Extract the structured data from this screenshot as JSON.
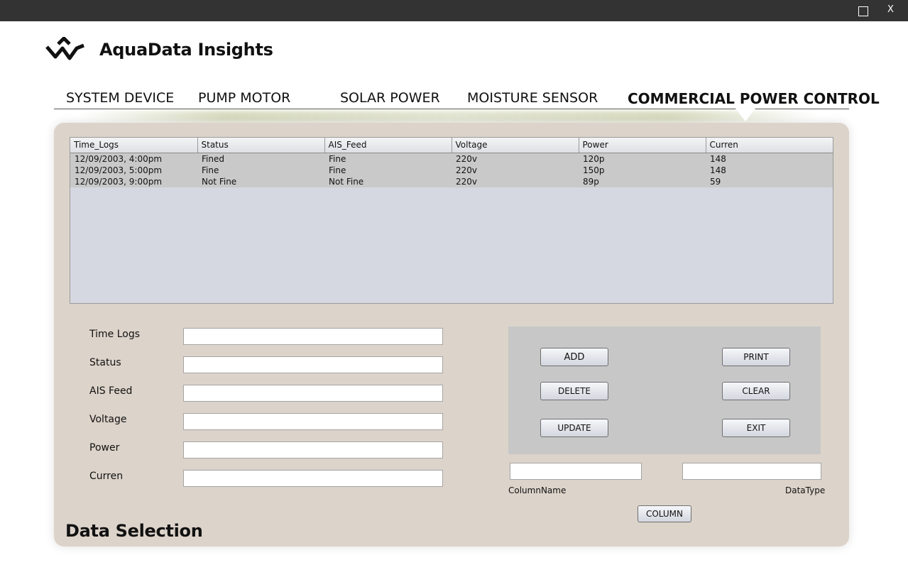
{
  "window": {
    "maximize_label": "",
    "close_label": "X"
  },
  "app": {
    "title": "AquaData Insights",
    "logo_icon": "wave-chevron-logo-icon"
  },
  "nav": {
    "items": [
      {
        "label": "SYSTEM DEVICE"
      },
      {
        "label": "PUMP MOTOR"
      },
      {
        "label": "SOLAR POWER"
      },
      {
        "label": "MOISTURE SENSOR"
      },
      {
        "label": "COMMERCIAL POWER CONTROL"
      }
    ],
    "active_index": 4
  },
  "table": {
    "columns": [
      "Time_Logs",
      "Status",
      "AIS_Feed",
      "Voltage",
      "Power",
      "Curren"
    ],
    "rows": [
      [
        "12/09/2003, 4:00pm",
        "Fined",
        "Fine",
        "220v",
        "120p",
        "148"
      ],
      [
        "12/09/2003, 5:00pm",
        "Fine",
        "Fine",
        "220v",
        "150p",
        "148"
      ],
      [
        "12/09/2003, 9:00pm",
        "Not Fine",
        "Not Fine",
        "220v",
        "89p",
        "59"
      ]
    ]
  },
  "form": {
    "fields": [
      {
        "label": "Time Logs",
        "value": ""
      },
      {
        "label": "Status",
        "value": ""
      },
      {
        "label": "AIS Feed",
        "value": ""
      },
      {
        "label": "Voltage",
        "value": ""
      },
      {
        "label": "Power",
        "value": ""
      },
      {
        "label": "Curren",
        "value": ""
      }
    ]
  },
  "buttons": {
    "add": "ADD",
    "print": "PRINT",
    "delete": "DELETE",
    "clear": "CLEAR",
    "update": "UPDATE",
    "exit": "EXIT",
    "column": "COLUMN"
  },
  "column_editor": {
    "column_name_label": "ColumnName",
    "column_name_value": "",
    "data_type_label": "DataType",
    "data_type_value": ""
  },
  "section": {
    "title": "Data Selection"
  },
  "colors": {
    "titlebar": "#333333",
    "panel": "#dcd3ca",
    "table_bg": "#d6d8e1",
    "row_bg": "#c9c9c9",
    "button_panel": "#c7c7c7"
  }
}
